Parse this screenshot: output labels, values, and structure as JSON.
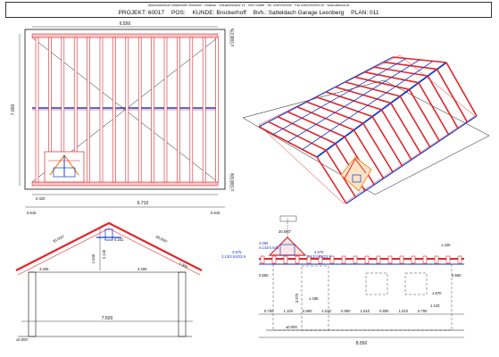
{
  "header": {
    "company": "Abbundzentrum Waldviertel Zimmerei - Holzbau · Industriestraße 14 · 3910 Zwettl · Tel. 02822/52000 · Fax 02822/52000-20 · www.abbund.at",
    "project_label": "PROJEKT: 60017",
    "pos_label": "POS:",
    "kunde_label": "KUNDE: Brockerhoff",
    "bvh_label": "Bvh.: Satteldach Garage Leonberg",
    "plan_label": "PLAN: 011"
  },
  "plan": {
    "width_top": "6.550",
    "depth_left": "7.000",
    "right_top_a": "0.475",
    "right_top_b": "0.150",
    "right_bottom_a": "0.500",
    "right_bottom_b": "0.150",
    "bottom_small": "0.420",
    "bottom_total": "6.710",
    "bottom_left_overhang": "0.615",
    "bottom_right_overhang": "0.615"
  },
  "section": {
    "pitch_left": "30.000°",
    "pitch_right": "30.000°",
    "ridge_width": "4.341",
    "ridge_height_a": "1.540",
    "ridge_height_b": "2.140",
    "eave_height_left": "3.205",
    "eave_height_right": "3.205",
    "overhang_right": "1.000",
    "span": "7.500",
    "base_level": "±0.000"
  },
  "elevation": {
    "pitch": "30.000°",
    "left_sill": "4.056",
    "left_sill_b": "4.143/4.543",
    "left_level_a": "3.875",
    "left_level_b": "3.13/3.510/3.9",
    "right_level_a": "3.875",
    "right_level_b": "3.13/3.510/3.9",
    "top_right": "1.425",
    "left_overhang": "0.550",
    "right_overhang": "0.550",
    "door_height": "3.370",
    "door_width": "1.435",
    "window_right": "1.670",
    "segments": [
      "0.700",
      "1.100",
      "0.900",
      "1.010",
      "0.900",
      "1.010",
      "0.900",
      "1.010",
      "0.700"
    ],
    "segment_last": "1.120",
    "total": "8.550",
    "base_level": "±0.000"
  },
  "colors": {
    "rafter_red": "#e0262b",
    "beam_blue": "#1a3cc8",
    "line_black": "#111111",
    "dormer_orange": "#f08a1c"
  }
}
